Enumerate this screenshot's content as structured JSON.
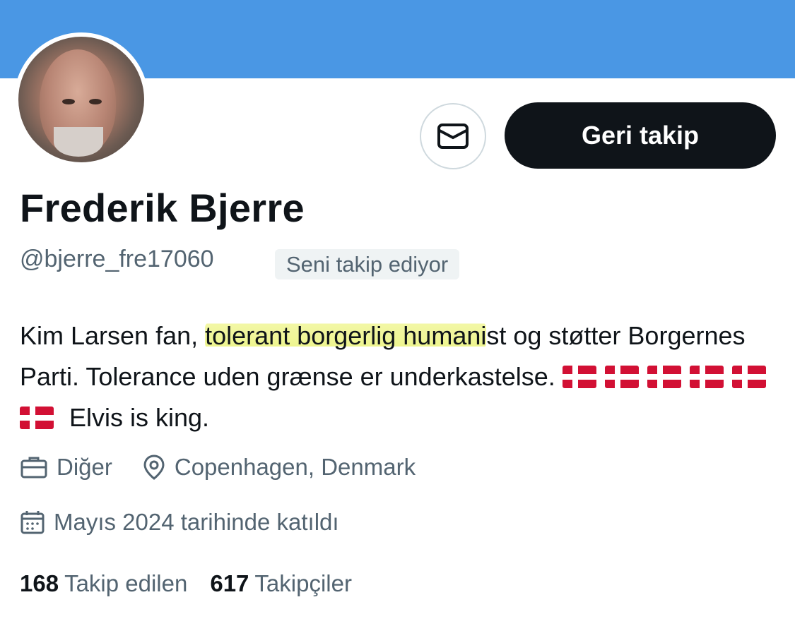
{
  "profile": {
    "name": "Frederik Bjerre",
    "handle": "@bjerre_fre17060",
    "follows_you_badge": "Seni takip ediyor",
    "follow_back_label": "Geri takip",
    "bio": {
      "part1": "Kim Larsen fan, ",
      "highlight": "tolerant borgerlig humani",
      "part2": "st og støtter Borgernes Parti. Tolerance uden grænse er underkastelse. ",
      "flag_count": 6,
      "part3": " Elvis is king."
    },
    "profession": "Diğer",
    "location": "Copenhagen, Denmark",
    "joined": "Mayıs 2024 tarihinde katıldı",
    "following_count": "168",
    "following_label": "Takip edilen",
    "followers_count": "617",
    "followers_label": "Takipçiler"
  },
  "colors": {
    "banner": "#4a97e4",
    "primary_text": "#0f1419",
    "secondary_text": "#536471",
    "highlight": "#eef58f",
    "flag_red": "#d21034"
  },
  "icons": [
    "mail-icon",
    "briefcase-icon",
    "location-pin-icon",
    "calendar-icon",
    "denmark-flag-icon"
  ]
}
